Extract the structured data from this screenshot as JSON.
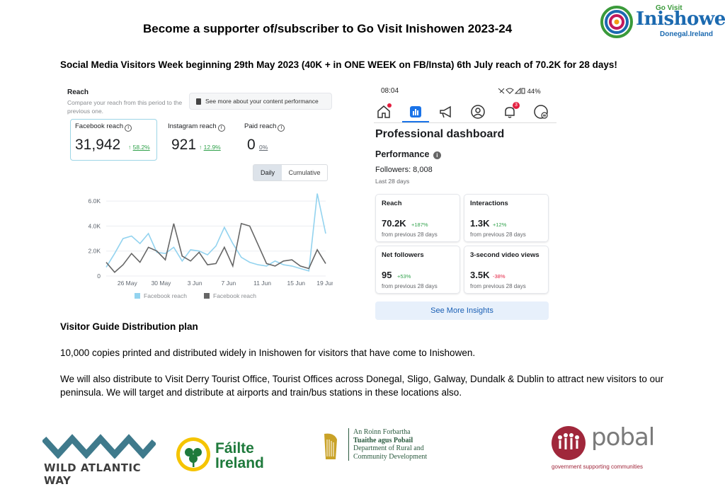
{
  "header": {
    "title": "Become a supporter of/subscriber to Go Visit Inishowen 2023-24",
    "logo": {
      "go_visit": "Go Visit",
      "name": "Inishowen",
      "sub": "Donegal.Ireland"
    }
  },
  "subtitle": "Social Media Visitors Week beginning 29th May 2023 (40K + in ONE WEEK on FB/Insta) 6th July reach of 70.2K for 28 days!",
  "fb_panel": {
    "reach_title": "Reach",
    "reach_desc": "Compare your reach from this period to the previous one.",
    "see_more": "See more about your content performance",
    "metrics": [
      {
        "label": "Facebook reach",
        "value": "31,942",
        "change": "↑",
        "change_pct": "58.2%"
      },
      {
        "label": "Instagram reach",
        "value": "921",
        "change": "↑",
        "change_pct": "12.9%"
      },
      {
        "label": "Paid reach",
        "value": "0",
        "change_pct": "0%"
      }
    ],
    "toggle": {
      "daily": "Daily",
      "cumulative": "Cumulative"
    }
  },
  "chart_data": {
    "type": "line",
    "y_ticks": [
      "6.0K",
      "4.0K",
      "2.0K",
      "0"
    ],
    "ylim": [
      0,
      6800
    ],
    "x_tick_labels": [
      "26 May",
      "30 May",
      "3 Jun",
      "7 Jun",
      "11 Jun",
      "15 Jun",
      "19 Jun"
    ],
    "series": [
      {
        "name": "Facebook reach",
        "color": "#93d3ef",
        "values": [
          700,
          1800,
          3000,
          3200,
          2600,
          3400,
          1900,
          1800,
          2300,
          1200,
          2100,
          2000,
          1700,
          2400,
          3900,
          2600,
          1500,
          1100,
          900,
          800,
          1200,
          900,
          800,
          600,
          400,
          6600,
          3400
        ]
      },
      {
        "name": "Facebook reach",
        "color": "#666666",
        "values": [
          1100,
          300,
          900,
          1800,
          1100,
          2300,
          2000,
          1300,
          4200,
          1600,
          1200,
          1900,
          900,
          1000,
          2300,
          800,
          4200,
          4000,
          2500,
          1000,
          800,
          1200,
          1300,
          800,
          600,
          2100,
          1000
        ]
      }
    ],
    "legend": [
      "Facebook reach",
      "Facebook reach"
    ]
  },
  "ig_panel": {
    "time": "08:04",
    "battery": "44%",
    "notifications": "3",
    "title": "Professional dashboard",
    "performance": "Performance",
    "followers": "Followers: 8,008",
    "period": "Last 28 days",
    "cards": [
      {
        "title": "Reach",
        "value": "70.2K",
        "change": "+187%",
        "prev": "from previous 28 days",
        "neg": false
      },
      {
        "title": "Interactions",
        "value": "1.3K",
        "change": "+12%",
        "prev": "from previous 28 days",
        "neg": false
      },
      {
        "title": "Net followers",
        "value": "95",
        "change": "+53%",
        "prev": "from previous 28 days",
        "neg": false
      },
      {
        "title": "3-second video views",
        "value": "3.5K",
        "change": "-38%",
        "prev": "from previous 28 days",
        "neg": true
      }
    ],
    "insights_button": "See More Insights"
  },
  "visitor_guide": {
    "title": "Visitor Guide Distribution plan",
    "p1": "10,000 copies printed and distributed widely in Inishowen for visitors that have come to Inishowen.",
    "p2": "We will also distribute to Visit Derry Tourist Office, Tourist Offices across Donegal, Sligo, Galway, Dundalk & Dublin to attract new visitors to our peninsula. We will target and distribute at airports and train/bus stations in these locations also."
  },
  "footer_logos": {
    "waw": "WILD ATLANTIC WAY",
    "failte_1": "Fáilte",
    "failte_2": "Ireland",
    "dept_1": "An Roinn Forbartha",
    "dept_2": "Tuaithe agus Pobail",
    "dept_3": "Department of Rural and",
    "dept_4": "Community Development",
    "pobal": "pobal",
    "pobal_tag": "government supporting communities"
  }
}
